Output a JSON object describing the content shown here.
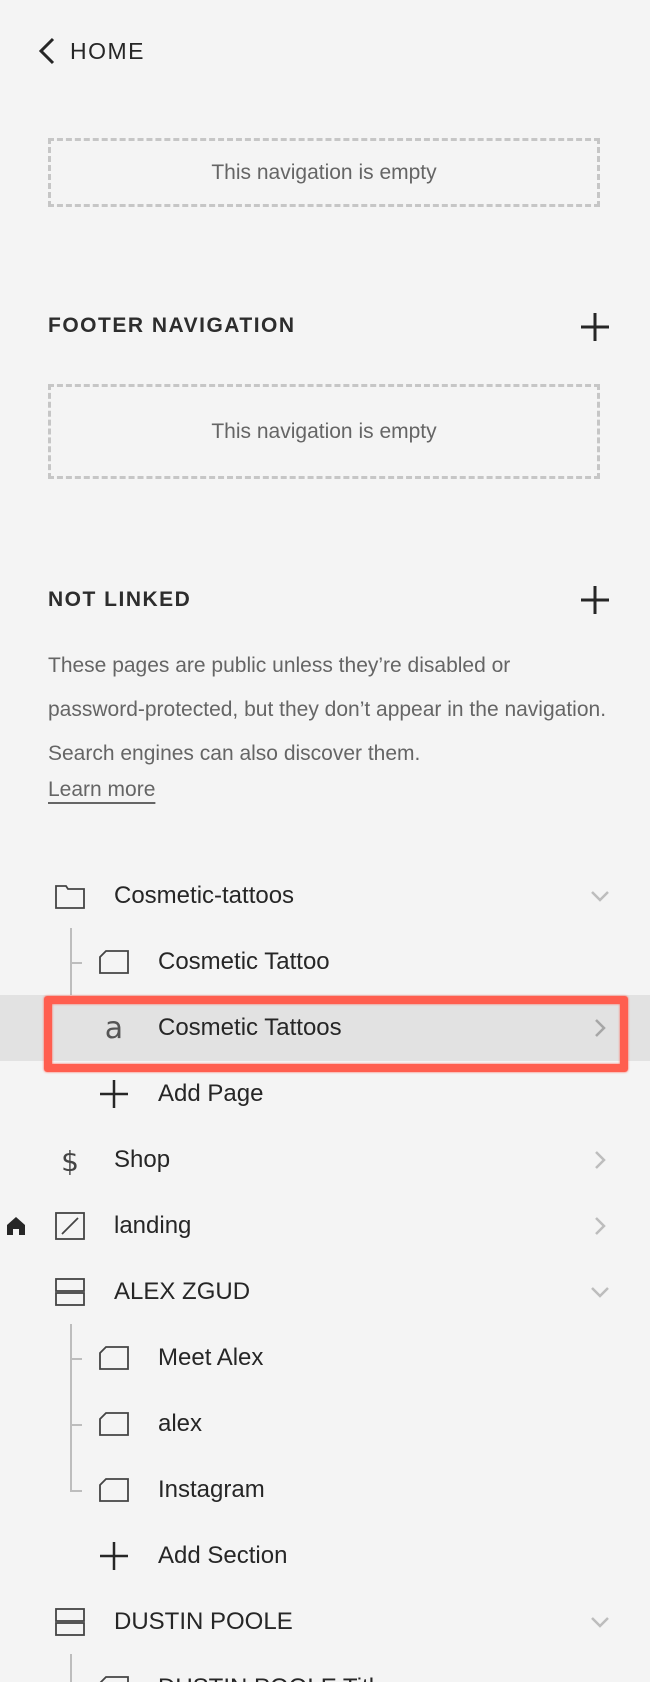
{
  "header": {
    "back_label": "HOME"
  },
  "main_nav": {
    "empty_text": "This navigation is empty"
  },
  "footer_nav": {
    "title": "FOOTER NAVIGATION",
    "empty_text": "This navigation is empty"
  },
  "not_linked": {
    "title": "NOT LINKED",
    "description": "These pages are public unless they’re disabled or password-protected, but they don’t appear in the navigation. Search engines can also discover them.",
    "learn_more": "Learn more"
  },
  "tree": {
    "folder_cosmetic": {
      "label": "Cosmetic-tattoos"
    },
    "page_cosmetic_tattoo": {
      "label": "Cosmetic Tattoo"
    },
    "page_cosmetic_tattoos": {
      "label": "Cosmetic Tattoos"
    },
    "add_page": {
      "label": "Add Page"
    },
    "shop": {
      "label": "Shop"
    },
    "landing": {
      "label": "landing"
    },
    "index_alex": {
      "label": "ALEX ZGUD"
    },
    "meet_alex": {
      "label": "Meet Alex"
    },
    "alex": {
      "label": "alex"
    },
    "instagram": {
      "label": "Instagram"
    },
    "add_section": {
      "label": "Add Section"
    },
    "index_dustin": {
      "label": "DUSTIN POOLE"
    },
    "dustin_child": {
      "label": "DUSTIN POOLE Title"
    }
  },
  "colors": {
    "background": "#f4f4f4",
    "selected_row": "#e2e2e2",
    "annotation": "#ff5e4f"
  }
}
